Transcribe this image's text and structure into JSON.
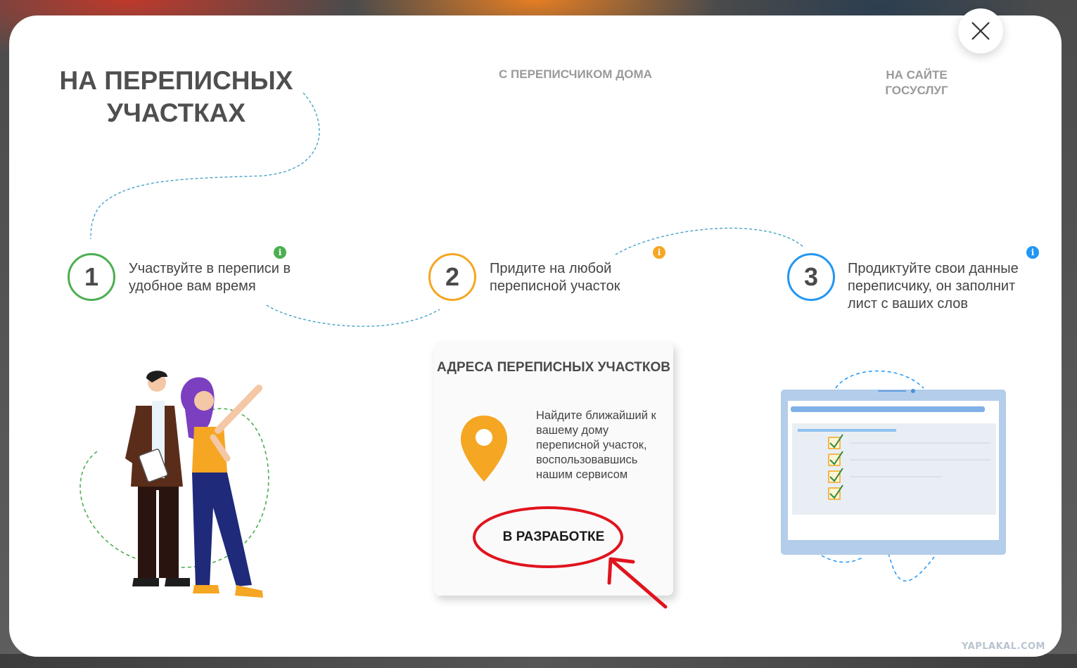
{
  "tabs": [
    {
      "label": "НА ПЕРЕПИСНЫХ УЧАСТКАХ",
      "active": true
    },
    {
      "label": "С ПЕРЕПИСЧИКОМ ДОМА",
      "active": false
    },
    {
      "label": "НА САЙТЕ ГОСУСЛУГ",
      "active": false
    }
  ],
  "steps": [
    {
      "number": "1",
      "text": "Участвуйте в переписи в удобное вам время",
      "color": "#4caf50"
    },
    {
      "number": "2",
      "text": "Придите на любой переписной участок",
      "color": "#f5a623"
    },
    {
      "number": "3",
      "text": "Продиктуйте свои данные переписчику, он заполнит лист с ваших слов",
      "color": "#2196f3"
    }
  ],
  "info_symbol": "i",
  "card": {
    "title": "АДРЕСА ПЕРЕПИСНЫХ УЧАСТКОВ",
    "text": "Найдите ближайший к вашему дому переписной участок, воспользовавшись нашим сервисом",
    "button_label": "В РАЗРАБОТКЕ"
  },
  "watermark": "YAPLAKAL.COM",
  "colors": {
    "highlight": "#e0141e",
    "pin": "#f5a623",
    "heading": "#4f4f4f",
    "muted": "#9a9a9a"
  },
  "icons": [
    "close-icon",
    "info-icon",
    "location-pin-icon",
    "checkbox-icon"
  ]
}
